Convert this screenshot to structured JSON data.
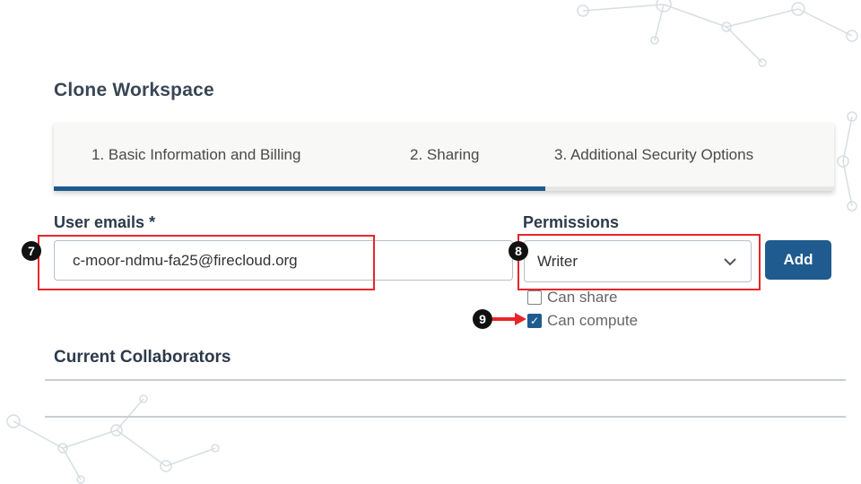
{
  "page_title": "Clone Workspace",
  "tabs": [
    {
      "label": "1. Basic Information and Billing"
    },
    {
      "label": "2. Sharing"
    },
    {
      "label": "3. Additional Security Options"
    }
  ],
  "progress_percent": 63,
  "user_emails": {
    "label": "User emails *",
    "value": "c-moor-ndmu-fa25@firecloud.org"
  },
  "permissions": {
    "label": "Permissions",
    "selected": "Writer"
  },
  "add_label": "Add",
  "checkboxes": [
    {
      "label": "Can share",
      "checked": false
    },
    {
      "label": "Can compute",
      "checked": true
    }
  ],
  "collaborators_heading": "Current Collaborators",
  "annotations": [
    "7",
    "8",
    "9"
  ],
  "colors": {
    "accent": "#1f5b8f",
    "highlight": "#e8262a"
  }
}
